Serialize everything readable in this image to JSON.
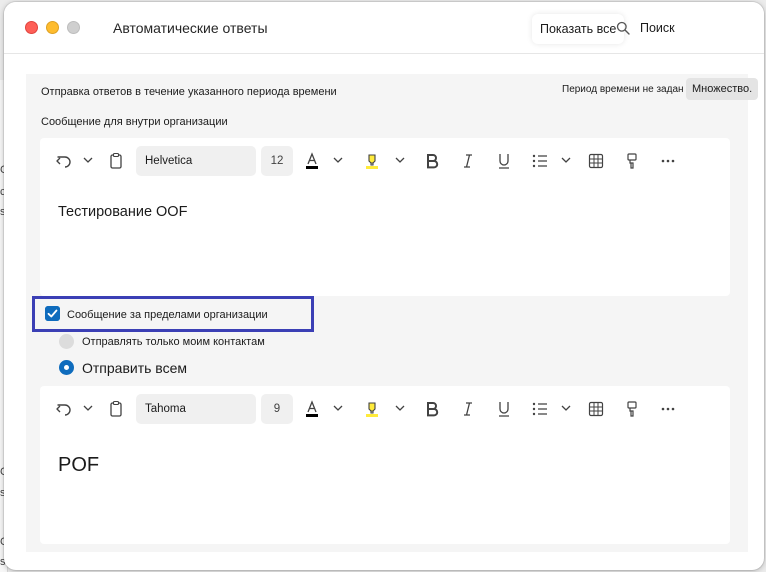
{
  "window": {
    "title": "Автоматические ответы",
    "show_all": "Показать все",
    "search": "Поиск"
  },
  "period": {
    "label": "Отправка ответов в течение указанного периода времени",
    "status": "Период времени не задан",
    "button": "Множество."
  },
  "internal": {
    "label": "Сообщение для внутри организации",
    "font": "Helvetica",
    "size": "12",
    "body": "Тестирование OOF"
  },
  "external": {
    "checkbox_label": "Сообщение за пределами организации",
    "checked": true,
    "option_contacts": "Отправлять только моим контактам",
    "option_all": "Отправить всем",
    "selected_option": "option_all",
    "font": "Tahoma",
    "size": "9",
    "body": "POF"
  },
  "colors": {
    "accent": "#0f6cbd",
    "focus_outline": "#3b3fb5",
    "highlight_yellow": "#ffeb3b"
  },
  "background_app": {
    "fragments": [
      "С",
      "с",
      "s",
      "С",
      "s",
      "С",
      "s."
    ]
  }
}
